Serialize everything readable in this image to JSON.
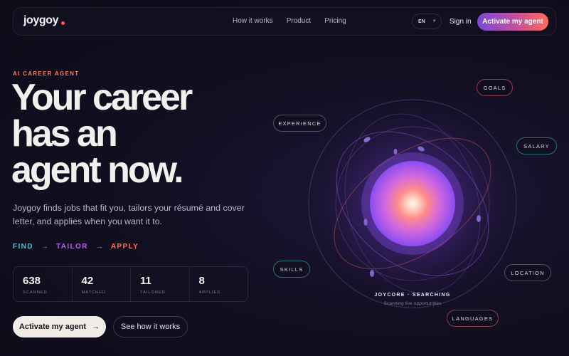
{
  "nav": {
    "brand": "joygoy",
    "links": [
      "How it works",
      "Product",
      "Pricing"
    ],
    "language": "EN",
    "signin": "Sign in",
    "cta": "Activate my agent"
  },
  "hero": {
    "eyebrow": "AI CAREER AGENT",
    "headline": [
      "Your career",
      "has an",
      "agent now."
    ],
    "subcopy": "Joygoy finds jobs that fit you, tailors your résumé and cover letter, and applies when you want it to.",
    "steps": [
      "FIND",
      "TAILOR",
      "APPLY"
    ],
    "step_arrow": "→",
    "stats": [
      {
        "value": "638",
        "label": "SCANNED"
      },
      {
        "value": "42",
        "label": "MATCHED"
      },
      {
        "value": "11",
        "label": "TAILORED"
      },
      {
        "value": "8",
        "label": "APPLIED"
      }
    ],
    "primary_button": "Activate my agent",
    "primary_arrow": "→",
    "secondary_button": "See how it works"
  },
  "orb": {
    "chips": {
      "experience": "EXPERIENCE",
      "goals": "GOALS",
      "salary": "SALARY",
      "skills": "SKILLS",
      "location": "LOCATION",
      "languages": "LANGUAGES"
    },
    "core_title": "JOYCORE · SEARCHING",
    "core_subtitle": "Scanning live opportunities"
  },
  "colors": {
    "accent_cyan": "#42c9d6",
    "accent_purple": "#b565e8",
    "accent_coral": "#ff7359",
    "cta_gradient": [
      "#7a4ad8",
      "#c2519b",
      "#ff6b5b"
    ]
  }
}
